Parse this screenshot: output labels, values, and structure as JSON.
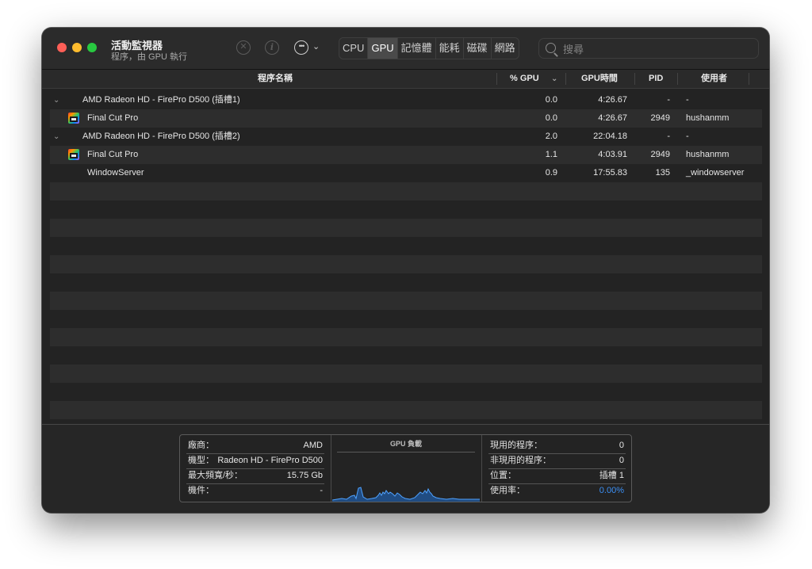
{
  "window": {
    "title": "活動監視器",
    "subtitle": "程序，由 GPU 執行"
  },
  "toolbar": {
    "stop_icon": "x-circle-icon",
    "info_icon": "info-circle-icon",
    "more_icon": "ellipsis-circle-icon",
    "tabs": [
      {
        "label": "CPU",
        "active": false
      },
      {
        "label": "GPU",
        "active": true
      },
      {
        "label": "記憶體",
        "active": false
      },
      {
        "label": "能耗",
        "active": false
      },
      {
        "label": "磁碟",
        "active": false
      },
      {
        "label": "網路",
        "active": false
      }
    ],
    "search_placeholder": "搜尋"
  },
  "table": {
    "headers": {
      "name": "程序名稱",
      "gpu": "% GPU",
      "gpu_time": "GPU時間",
      "pid": "PID",
      "user": "使用者"
    },
    "rows": [
      {
        "type": "group",
        "name": "AMD Radeon HD - FirePro D500 (插槽1)",
        "gpu": "0.0",
        "time": "4:26.67",
        "pid": "-",
        "user": "-"
      },
      {
        "type": "proc",
        "icon": "final-cut-pro-icon",
        "name": "Final Cut Pro",
        "gpu": "0.0",
        "time": "4:26.67",
        "pid": "2949",
        "user": "hushanmm"
      },
      {
        "type": "group",
        "name": "AMD Radeon HD - FirePro D500 (插槽2)",
        "gpu": "2.0",
        "time": "22:04.18",
        "pid": "-",
        "user": "-"
      },
      {
        "type": "proc",
        "icon": "final-cut-pro-icon",
        "name": "Final Cut Pro",
        "gpu": "1.1",
        "time": "4:03.91",
        "pid": "2949",
        "user": "hushanmm"
      },
      {
        "type": "proc",
        "icon": "",
        "name": "WindowServer",
        "gpu": "0.9",
        "time": "17:55.83",
        "pid": "135",
        "user": "_windowserver"
      }
    ]
  },
  "info": {
    "left": [
      {
        "k": "廠商：",
        "v": "AMD"
      },
      {
        "k": "機型：",
        "v": "Radeon HD - FirePro D500"
      },
      {
        "k": "最大頻寬/秒：",
        "v": "15.75 Gb"
      },
      {
        "k": "機件：",
        "v": "-"
      }
    ],
    "chart_title": "GPU 負載",
    "right": [
      {
        "k": "現用的程序：",
        "v": "0"
      },
      {
        "k": "非現用的程序：",
        "v": "0"
      },
      {
        "k": "位置：",
        "v": "插槽 1"
      },
      {
        "k": "使用率：",
        "v": "0.00%"
      }
    ],
    "accent_color": "#3b8ff4"
  }
}
